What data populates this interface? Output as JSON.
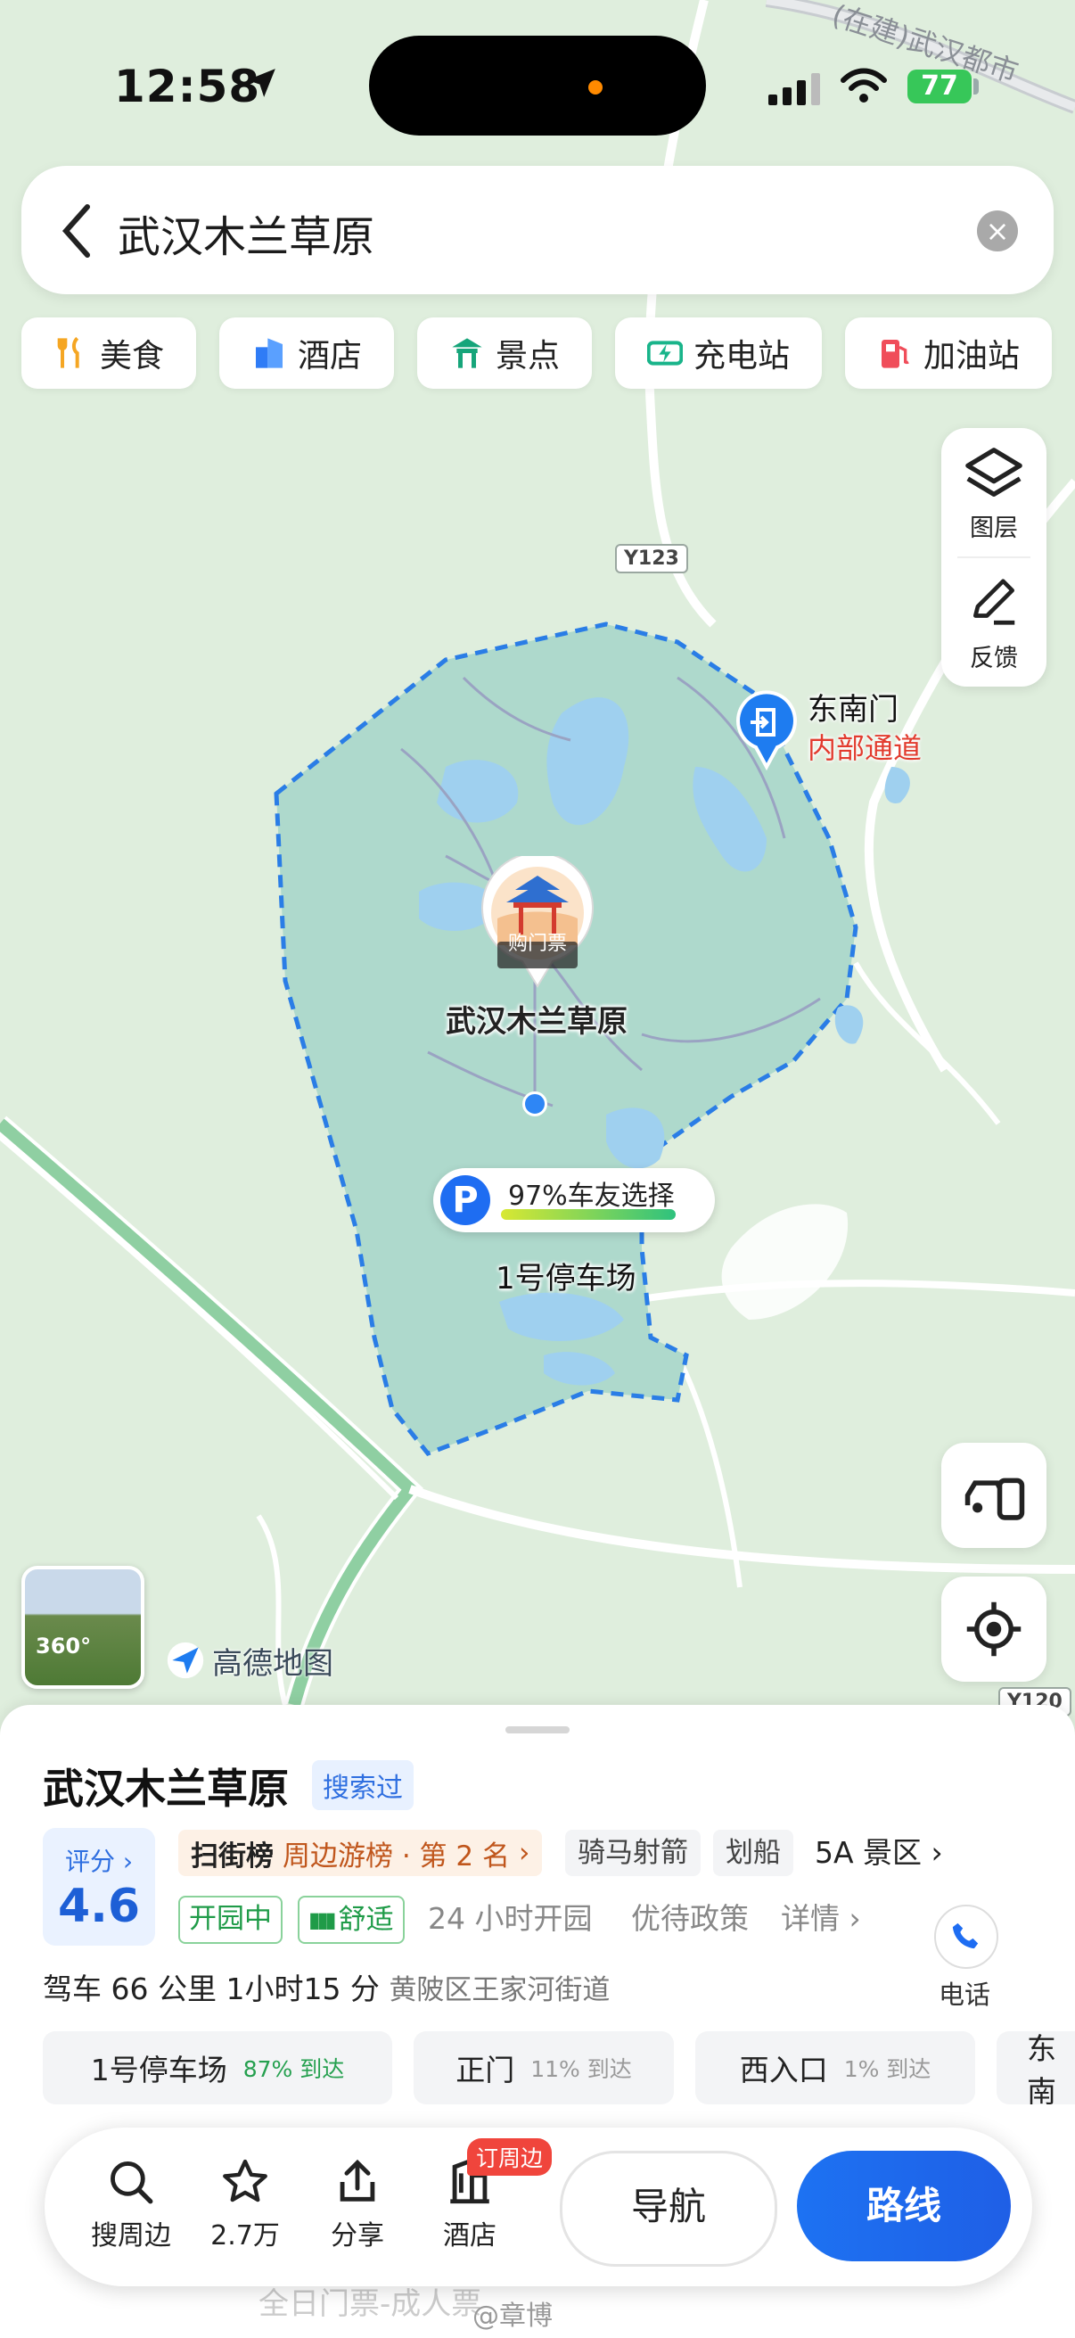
{
  "status": {
    "time": "12:58",
    "battery": "77"
  },
  "search": {
    "query": "武汉木兰草原"
  },
  "categories": [
    {
      "label": "美食",
      "icon": "food-icon",
      "color": "#f5a623"
    },
    {
      "label": "酒店",
      "icon": "hotel-icon",
      "color": "#2f7cf6"
    },
    {
      "label": "景点",
      "icon": "scenic-icon",
      "color": "#16a57a"
    },
    {
      "label": "充电站",
      "icon": "charging-icon",
      "color": "#19b48a"
    },
    {
      "label": "加油站",
      "icon": "gas-station-icon",
      "color": "#f04d5a"
    }
  ],
  "tools": {
    "layers": "图层",
    "feedback": "反馈"
  },
  "map": {
    "roads": [
      "Y123",
      "Y120",
      "(在建)武汉都市"
    ],
    "gate": {
      "name": "东南门",
      "note": "内部通道"
    },
    "poi": {
      "name": "武汉木兰草原",
      "ticket": "购门票"
    },
    "parking": {
      "name": "1号停车场",
      "choice": "97%车友选择",
      "choice_percent": 97
    },
    "brand": "高德地图",
    "panorama": "360°"
  },
  "sheet": {
    "title": "武汉木兰草原",
    "searched": "搜索过",
    "rating_label": "评分",
    "rating": "4.6",
    "rank_prefix": "扫街榜",
    "rank": "周边游榜 · 第 2 名",
    "tags": [
      "骑马射箭",
      "划船"
    ],
    "level": "5A 景区",
    "open_status": "开园中",
    "comfort": "舒适",
    "hours": "24 小时开园",
    "policy": "优待政策",
    "details": "详情",
    "drive": "驾车 66 公里 1小时15 分",
    "address": "黄陂区王家河街道",
    "phone": "电话",
    "entries": [
      {
        "name": "1号停车场",
        "pct": "87% 到达"
      },
      {
        "name": "正门",
        "pct": "11% 到达"
      },
      {
        "name": "西入口",
        "pct": "1% 到达"
      },
      {
        "name": "东南",
        "pct": ""
      }
    ]
  },
  "toolbar": {
    "nearby": "搜周边",
    "favorites": "2.7万",
    "share": "分享",
    "hotel": "酒店",
    "hotel_badge": "订周边",
    "navigate": "导航",
    "route": "路线"
  },
  "footer": {
    "faded": "全日门票-成人票",
    "watermark": "@章博"
  }
}
